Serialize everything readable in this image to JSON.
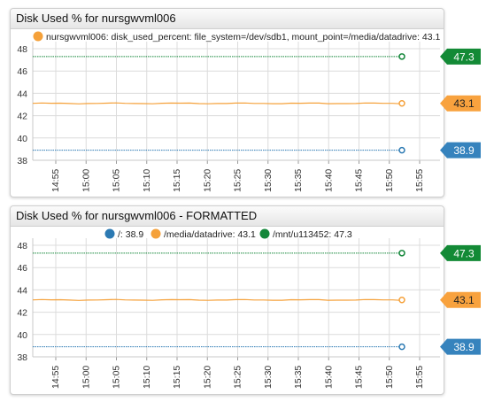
{
  "chart_data": [
    {
      "type": "line",
      "title": "Disk Used % for nursgwvml006",
      "legend": [
        "nursgwvml006: disk_used_percent: file_system=/dev/sdb1, mount_point=/media/datadrive: 43.1"
      ],
      "yticks": [
        "38",
        "40",
        "42",
        "44",
        "46",
        "48"
      ],
      "ylim": [
        38,
        48
      ],
      "xticks": [
        "14:55",
        "15:00",
        "15:05",
        "15:10",
        "15:15",
        "15:20",
        "15:25",
        "15:30",
        "15:35",
        "15:40",
        "15:45",
        "15:50",
        "15:55"
      ],
      "grid": true,
      "series": [
        {
          "name": "",
          "color": "#2c7ab3",
          "value": 38.9,
          "label": "38.9",
          "label_bg": "#3683bd",
          "label_fg": "#ffffff"
        },
        {
          "name": "",
          "color": "#f5a13a",
          "value": 43.1,
          "label": "43.1",
          "label_bg": "#f8a23e",
          "label_fg": "#222222"
        },
        {
          "name": "",
          "color": "#14873a",
          "value": 47.3,
          "label": "47.3",
          "label_bg": "#138a36",
          "label_fg": "#ffffff"
        }
      ]
    },
    {
      "type": "line",
      "title": "Disk Used % for nursgwvml006 - FORMATTED",
      "legend": [
        "/: 38.9",
        "/media/datadrive: 43.1",
        "/mnt/u113452: 47.3"
      ],
      "yticks": [
        "38",
        "40",
        "42",
        "44",
        "46",
        "48"
      ],
      "ylim": [
        38,
        48
      ],
      "xticks": [
        "14:55",
        "15:00",
        "15:05",
        "15:10",
        "15:15",
        "15:20",
        "15:25",
        "15:30",
        "15:35",
        "15:40",
        "15:45",
        "15:50",
        "15:55"
      ],
      "grid": true,
      "series": [
        {
          "name": "/",
          "color": "#2c7ab3",
          "value": 38.9,
          "label": "38.9",
          "label_bg": "#3683bd",
          "label_fg": "#ffffff"
        },
        {
          "name": "/media/datadrive",
          "color": "#f5a13a",
          "value": 43.1,
          "label": "43.1",
          "label_bg": "#f8a23e",
          "label_fg": "#222222"
        },
        {
          "name": "/mnt/u113452",
          "color": "#14873a",
          "value": 47.3,
          "label": "47.3",
          "label_bg": "#138a36",
          "label_fg": "#ffffff"
        }
      ]
    }
  ]
}
